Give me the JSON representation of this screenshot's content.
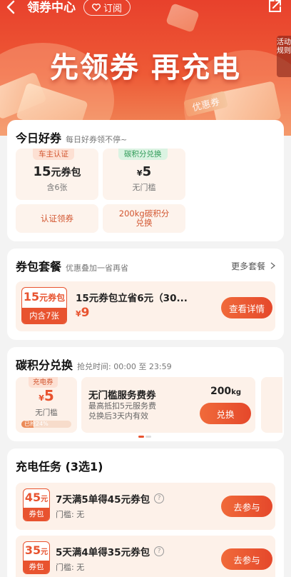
{
  "header": {
    "title": "领券中心",
    "subscribe_label": "订阅",
    "headline": "先领券 再充电",
    "rules_label": "活动规则",
    "deco_label": "优惠券"
  },
  "today": {
    "title": "今日好券",
    "subtitle": "每日好券领不停~",
    "items": [
      {
        "tag": "车主认证",
        "amount": "15",
        "unit": "元券包",
        "desc": "含6张",
        "action": "认证领券"
      },
      {
        "tag": "碳积分兑换",
        "currency": "¥",
        "amount": "5",
        "desc": "无门槛",
        "action": "200kg碳积分兑换"
      }
    ]
  },
  "package": {
    "title": "券包套餐",
    "subtitle": "优惠叠加一省再省",
    "more_label": "更多套餐",
    "badge_amount": "15",
    "badge_unit": "元券包",
    "badge_count": "内含7张",
    "name": "15元券包立省6元（30...",
    "currency": "¥",
    "price": "9",
    "button": "查看详情"
  },
  "carbon": {
    "title": "碳积分兑换",
    "time_label": "抢兑时间: 00:00 至 23:59",
    "slot": {
      "tag": "充电券",
      "currency": "¥",
      "amount": "5",
      "desc": "无门槛",
      "progress_label": "已抢24%",
      "progress": 0.24
    },
    "info": {
      "title": "无门槛服务费券",
      "line1": "最高抵扣5元服务费",
      "line2": "兑换后3天内有效",
      "points": "200",
      "points_unit": "kg",
      "button": "兑换"
    }
  },
  "tasks": {
    "title": "充电任务 (3选1)",
    "items": [
      {
        "amount": "45",
        "unit": "元",
        "badge_label": "券包",
        "name": "7天满5单得45元券包",
        "threshold": "门槛: 无",
        "button": "去参与"
      },
      {
        "amount": "35",
        "unit": "元",
        "badge_label": "券包",
        "name": "5天满4单得35元券包",
        "threshold": "门槛: 无",
        "button": "去参与"
      }
    ]
  },
  "colors": {
    "accent": "#e8532f",
    "banner": "#e8412c",
    "card_bg": "#fdf1e9",
    "green_tag": "#2e9a57"
  },
  "icons": [
    "back-arrow-icon",
    "heart-icon",
    "share-icon",
    "chevron-right-icon",
    "question-icon"
  ]
}
